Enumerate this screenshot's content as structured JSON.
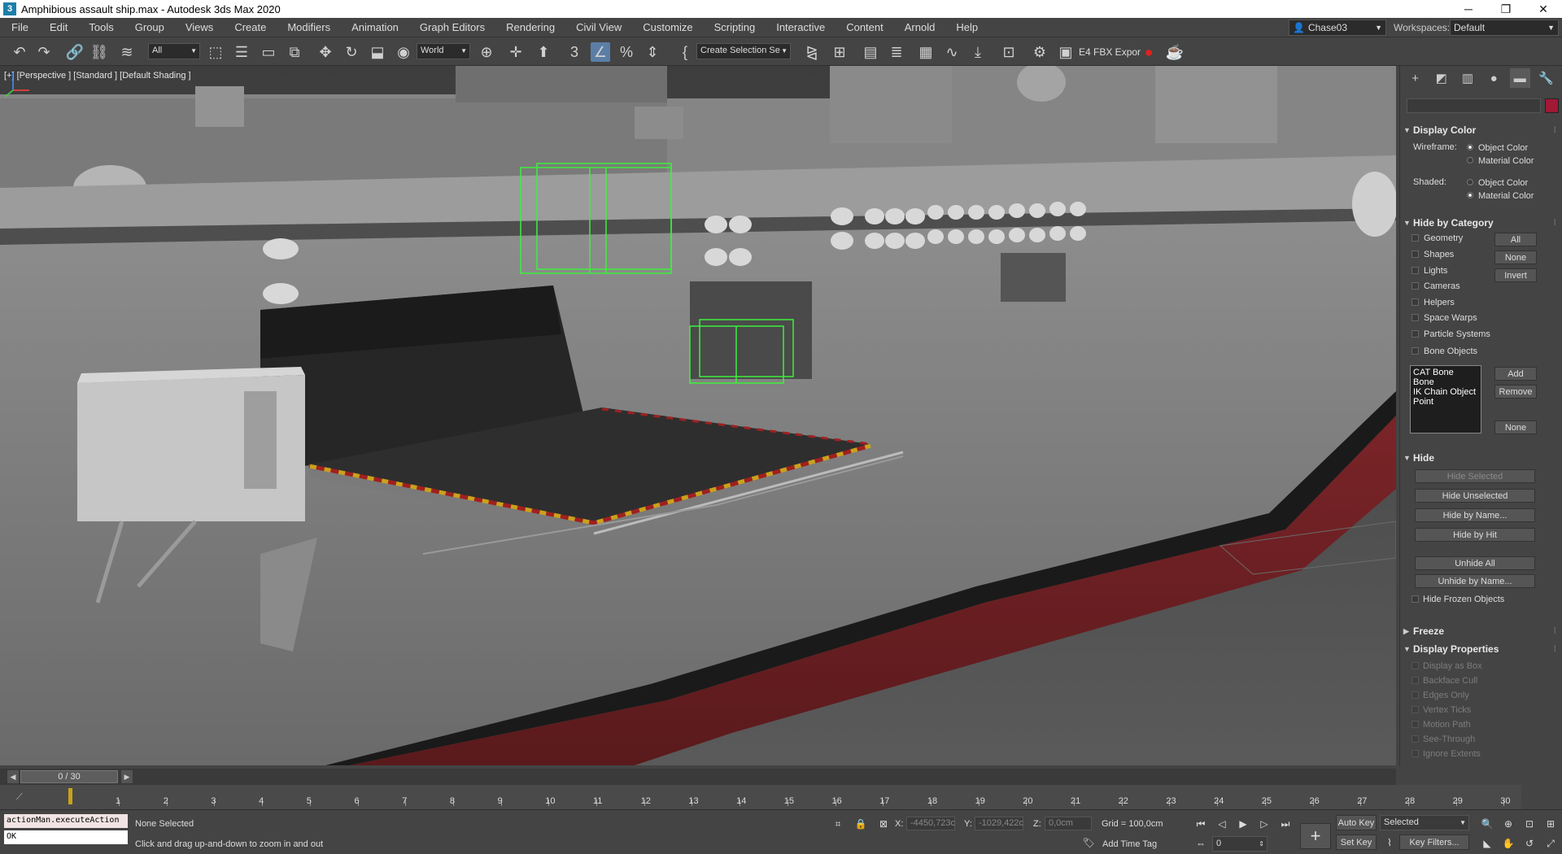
{
  "window": {
    "title": "Amphibious assault ship.max - Autodesk 3ds Max 2020",
    "min_icon": "minimize-icon",
    "max_icon": "restore-icon",
    "close_icon": "close-icon"
  },
  "menubar": {
    "items": [
      "File",
      "Edit",
      "Tools",
      "Group",
      "Views",
      "Create",
      "Modifiers",
      "Animation",
      "Graph Editors",
      "Rendering",
      "Civil View",
      "Customize",
      "Scripting",
      "Interactive",
      "Content",
      "Arnold",
      "Help"
    ],
    "user": "Chase03",
    "workspaces_label": "Workspaces:",
    "workspace": "Default"
  },
  "toolbar": {
    "selection_filter": "All",
    "ref_coord": "World",
    "named_selection": "Create Selection Se",
    "fbx_label": "E4 FBX Expor"
  },
  "viewport": {
    "label": "[+] [Perspective ] [Standard ] [Default Shading ]"
  },
  "colors": {
    "object_swatch": "#a01935",
    "selection_wire": "#3cf03c",
    "hull_red": "#6e1f22"
  },
  "command_panel": {
    "tabs": [
      "create-icon",
      "modify-icon",
      "hierarchy-icon",
      "motion-icon",
      "display-icon",
      "utilities-icon"
    ],
    "display_color": {
      "title": "Display Color",
      "wireframe_label": "Wireframe:",
      "shaded_label": "Shaded:",
      "object_color": "Object Color",
      "material_color": "Material Color",
      "wireframe_selected": "Object Color",
      "shaded_selected": "Material Color"
    },
    "hide_by_category": {
      "title": "Hide by Category",
      "items": [
        "Geometry",
        "Shapes",
        "Lights",
        "Cameras",
        "Helpers",
        "Space Warps",
        "Particle Systems",
        "Bone Objects"
      ],
      "btn_all": "All",
      "btn_none": "None",
      "btn_invert": "Invert",
      "list": [
        "CAT Bone",
        "Bone",
        "IK Chain Object",
        "Point"
      ],
      "btn_add": "Add",
      "btn_remove": "Remove",
      "btn_none2": "None"
    },
    "hide": {
      "title": "Hide",
      "hide_selected": "Hide Selected",
      "hide_unselected": "Hide Unselected",
      "hide_by_name": "Hide by Name...",
      "hide_by_hit": "Hide by Hit",
      "unhide_all": "Unhide All",
      "unhide_by_name": "Unhide by Name...",
      "hide_frozen": "Hide Frozen Objects"
    },
    "freeze": {
      "title": "Freeze"
    },
    "display_properties": {
      "title": "Display Properties",
      "items": [
        "Display as Box",
        "Backface Cull",
        "Edges Only",
        "Vertex Ticks",
        "Motion Path",
        "See-Through",
        "Ignore Extents"
      ]
    }
  },
  "timeline": {
    "slider": "0 / 30",
    "ticks": [
      "1",
      "2",
      "3",
      "4",
      "5",
      "6",
      "7",
      "8",
      "9",
      "10",
      "11",
      "12",
      "13",
      "14",
      "15",
      "16",
      "17",
      "18",
      "19",
      "20",
      "21",
      "22",
      "23",
      "24",
      "25",
      "26",
      "27",
      "28",
      "29",
      "30"
    ]
  },
  "status": {
    "maxscript_input": "actionMan.executeAction",
    "maxscript_output": "OK",
    "selection": "None Selected",
    "prompt": "Click and drag up-and-down to zoom in and out",
    "x_label": "X:",
    "x_value": "-4450,723c",
    "y_label": "Y:",
    "y_value": "-1029,422c",
    "z_label": "Z:",
    "z_value": "0,0cm",
    "grid": "Grid = 100,0cm",
    "add_time_tag": "Add Time Tag",
    "auto_key": "Auto Key",
    "set_key": "Set Key",
    "key_mode": "Selected",
    "key_filters": "Key Filters...",
    "frame": "0"
  }
}
